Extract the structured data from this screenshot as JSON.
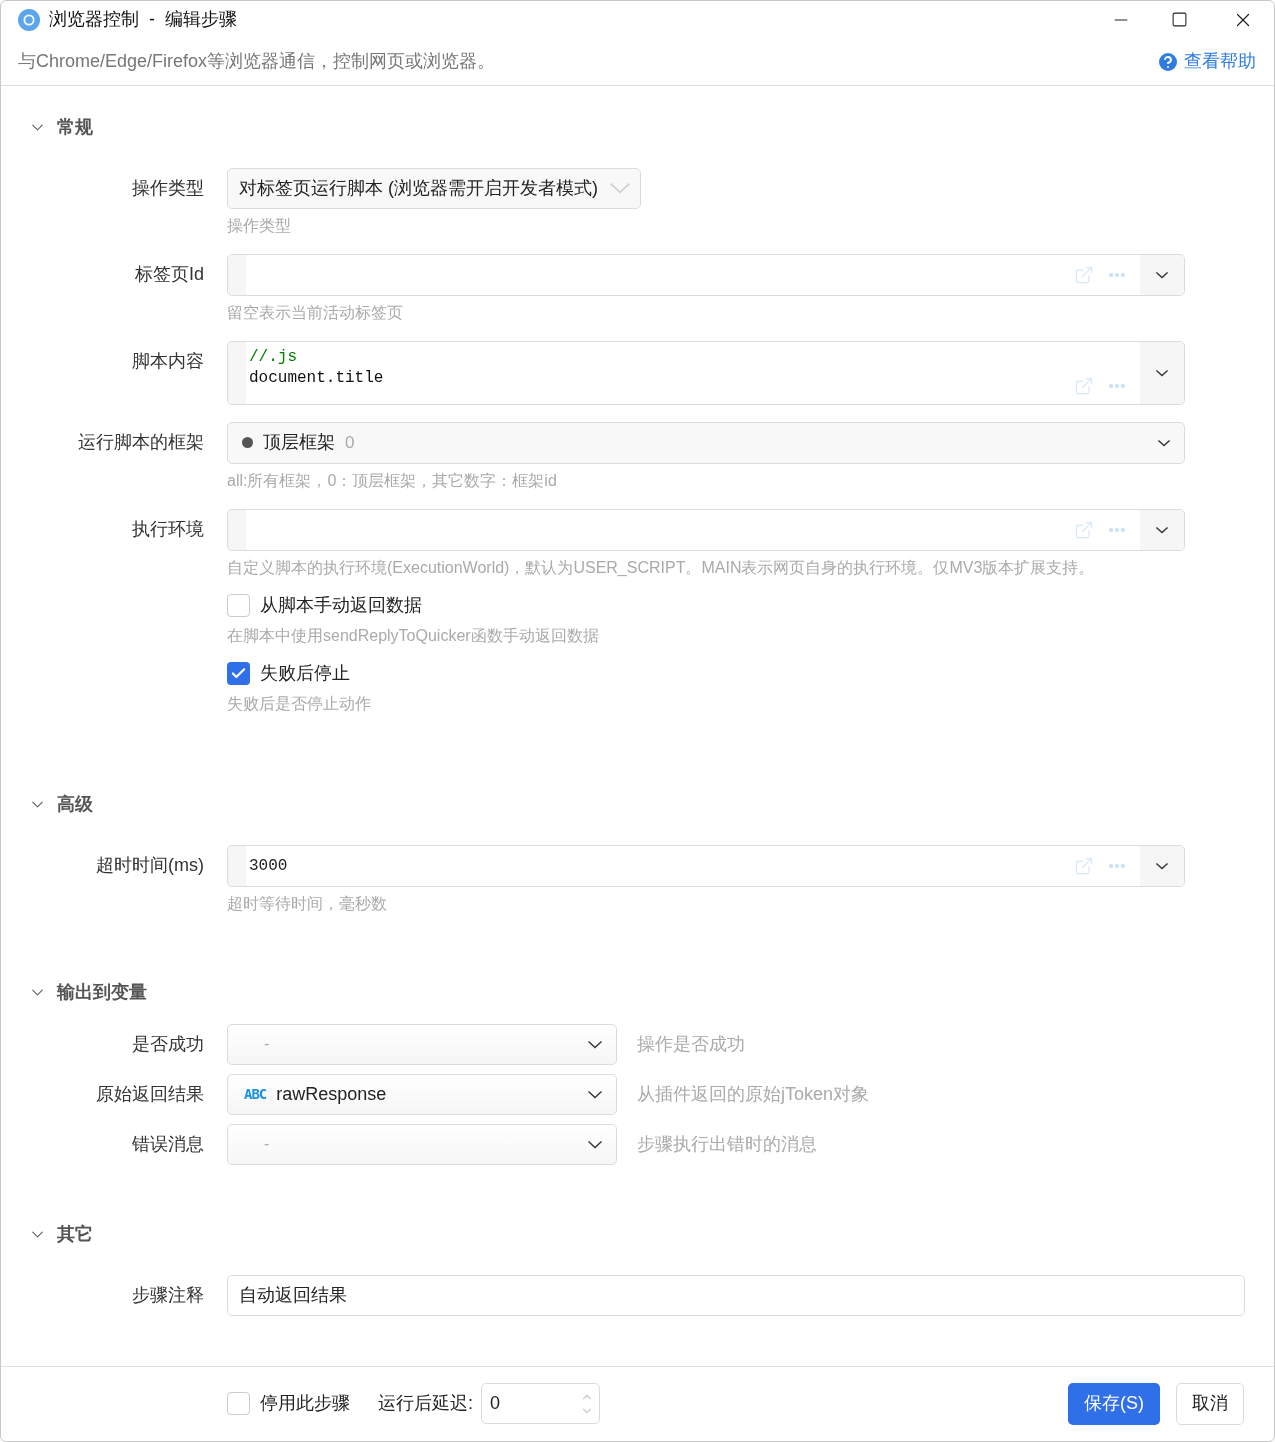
{
  "window": {
    "title": "浏览器控制  -  编辑步骤",
    "subtitle": "与Chrome/Edge/Firefox等浏览器通信，控制网页或浏览器。",
    "help_link": "查看帮助"
  },
  "sections": [
    {
      "title": "常规",
      "expanded": true,
      "fields": [
        {
          "kind": "select",
          "label": "操作类型",
          "value": "对标签页运行脚本 (浏览器需开启开发者模式)",
          "hint": "操作类型"
        },
        {
          "kind": "combo",
          "label": "标签页Id",
          "hint": "留空表示当前活动标签页"
        },
        {
          "kind": "code",
          "label": "脚本内容",
          "comment": "//.js",
          "code": "document.title"
        },
        {
          "kind": "frame",
          "label": "运行脚本的框架",
          "value": "顶层框架",
          "detail": "0",
          "hint": "all:所有框架，0：顶层框架，其它数字：框架id"
        },
        {
          "kind": "combo",
          "label": "执行环境",
          "hint": "自定义脚本的执行环境(ExecutionWorld)，默认为USER_SCRIPT。MAIN表示网页自身的执行环境。仅MV3版本扩展支持。"
        },
        {
          "kind": "checkbox",
          "label": "从脚本手动返回数据",
          "checked": false,
          "hint": "在脚本中使用sendReplyToQuicker函数手动返回数据"
        },
        {
          "kind": "checkbox",
          "label": "失败后停止",
          "checked": true,
          "hint": "失败后是否停止动作"
        }
      ]
    },
    {
      "title": "高级",
      "expanded": true,
      "fields": [
        {
          "kind": "combo",
          "label": "超时时间(ms)",
          "value": "3000",
          "hint": "超时等待时间，毫秒数"
        }
      ]
    },
    {
      "title": "输出到变量",
      "expanded": true,
      "fields": [
        {
          "kind": "variable",
          "label": "是否成功",
          "placeholder": "-",
          "description": "操作是否成功"
        },
        {
          "kind": "variable",
          "label": "原始返回结果",
          "type_badge": "ABC",
          "value": "rawResponse",
          "description": "从插件返回的原始jToken对象"
        },
        {
          "kind": "variable",
          "label": "错误消息",
          "placeholder": "-",
          "description": "步骤执行出错时的消息"
        }
      ]
    },
    {
      "title": "其它",
      "expanded": true,
      "fields": [
        {
          "kind": "text",
          "label": "步骤注释",
          "value": "自动返回结果"
        }
      ]
    }
  ],
  "footer": {
    "disable_step": {
      "label": "停用此步骤",
      "checked": false
    },
    "delay_label": "运行后延迟:",
    "delay_value": "0",
    "buttons": [
      {
        "label": "保存(S)",
        "kind": "primary"
      },
      {
        "label": "取消",
        "kind": "secondary"
      }
    ]
  }
}
